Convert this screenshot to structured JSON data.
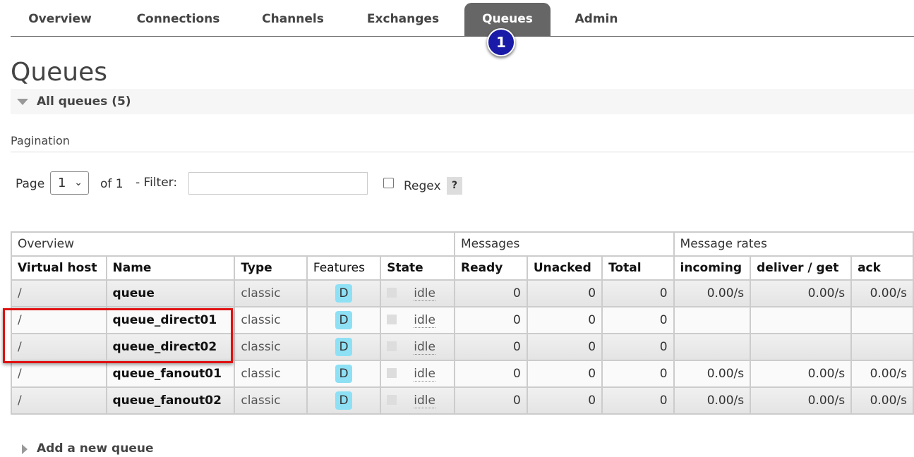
{
  "nav": {
    "tabs": [
      "Overview",
      "Connections",
      "Channels",
      "Exchanges",
      "Queues",
      "Admin"
    ],
    "active": "Queues"
  },
  "annotation_badge": "1",
  "page_title": "Queues",
  "section_title": "All queues (5)",
  "pagination": {
    "heading": "Pagination",
    "page_label": "Page",
    "page_value": "1",
    "of_label": "of 1",
    "filter_label": "- Filter:",
    "filter_value": "",
    "regex_label": "Regex",
    "help": "?"
  },
  "table": {
    "groups": [
      "Overview",
      "Messages",
      "Message rates"
    ],
    "columns": [
      "Virtual host",
      "Name",
      "Type",
      "Features",
      "State",
      "Ready",
      "Unacked",
      "Total",
      "incoming",
      "deliver / get",
      "ack"
    ],
    "rows": [
      {
        "vhost": "/",
        "name": "queue",
        "type": "classic",
        "feature": "D",
        "state": "idle",
        "ready": "0",
        "unacked": "0",
        "total": "0",
        "incoming": "0.00/s",
        "deliver": "0.00/s",
        "ack": "0.00/s"
      },
      {
        "vhost": "/",
        "name": "queue_direct01",
        "type": "classic",
        "feature": "D",
        "state": "idle",
        "ready": "0",
        "unacked": "0",
        "total": "0",
        "incoming": "",
        "deliver": "",
        "ack": ""
      },
      {
        "vhost": "/",
        "name": "queue_direct02",
        "type": "classic",
        "feature": "D",
        "state": "idle",
        "ready": "0",
        "unacked": "0",
        "total": "0",
        "incoming": "",
        "deliver": "",
        "ack": ""
      },
      {
        "vhost": "/",
        "name": "queue_fanout01",
        "type": "classic",
        "feature": "D",
        "state": "idle",
        "ready": "0",
        "unacked": "0",
        "total": "0",
        "incoming": "0.00/s",
        "deliver": "0.00/s",
        "ack": "0.00/s"
      },
      {
        "vhost": "/",
        "name": "queue_fanout02",
        "type": "classic",
        "feature": "D",
        "state": "idle",
        "ready": "0",
        "unacked": "0",
        "total": "0",
        "incoming": "0.00/s",
        "deliver": "0.00/s",
        "ack": "0.00/s"
      }
    ]
  },
  "add_queue": "Add a new queue",
  "colors": {
    "active_tab": "#666666",
    "feature_badge": "#8ee0f5",
    "highlight": "#e01010",
    "annotation": "#1a1aa8"
  }
}
